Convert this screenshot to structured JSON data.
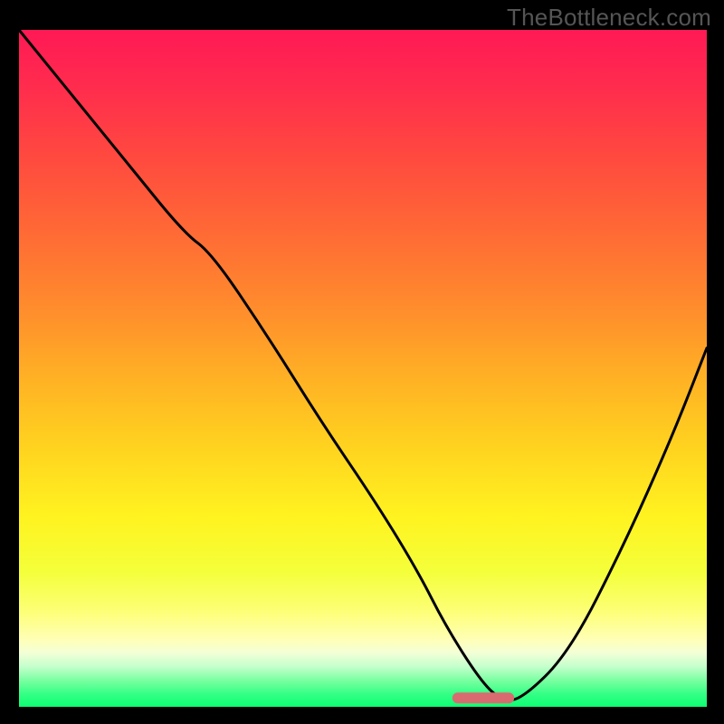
{
  "watermark": "TheBottleneck.com",
  "chart_data": {
    "type": "line",
    "title": "",
    "xlabel": "",
    "ylabel": "",
    "xlim": [
      0,
      100
    ],
    "ylim": [
      0,
      100
    ],
    "series": [
      {
        "name": "curve",
        "x": [
          0,
          8,
          16,
          24,
          28,
          36,
          44,
          52,
          58,
          62,
          67,
          70,
          73,
          80,
          88,
          95,
          100
        ],
        "y": [
          100,
          90,
          80,
          70,
          67,
          55,
          42,
          30,
          20,
          12,
          4,
          1,
          1,
          8,
          24,
          40,
          53
        ]
      }
    ],
    "marker": {
      "x_start": 63,
      "x_end": 72,
      "y": 0.5
    },
    "gradient_stops": [
      {
        "offset": 0,
        "color": "#ff1955"
      },
      {
        "offset": 8,
        "color": "#ff2b4e"
      },
      {
        "offset": 18,
        "color": "#ff4740"
      },
      {
        "offset": 30,
        "color": "#ff6a35"
      },
      {
        "offset": 42,
        "color": "#ff8f2c"
      },
      {
        "offset": 52,
        "color": "#ffb324"
      },
      {
        "offset": 62,
        "color": "#ffd41f"
      },
      {
        "offset": 72,
        "color": "#fff320"
      },
      {
        "offset": 80,
        "color": "#f4ff3a"
      },
      {
        "offset": 86,
        "color": "#fdff77"
      },
      {
        "offset": 90,
        "color": "#ffffb5"
      },
      {
        "offset": 92,
        "color": "#f3ffd6"
      },
      {
        "offset": 94,
        "color": "#c6ffcd"
      },
      {
        "offset": 96,
        "color": "#7effa3"
      },
      {
        "offset": 98,
        "color": "#37ff86"
      },
      {
        "offset": 100,
        "color": "#0cff73"
      }
    ]
  }
}
